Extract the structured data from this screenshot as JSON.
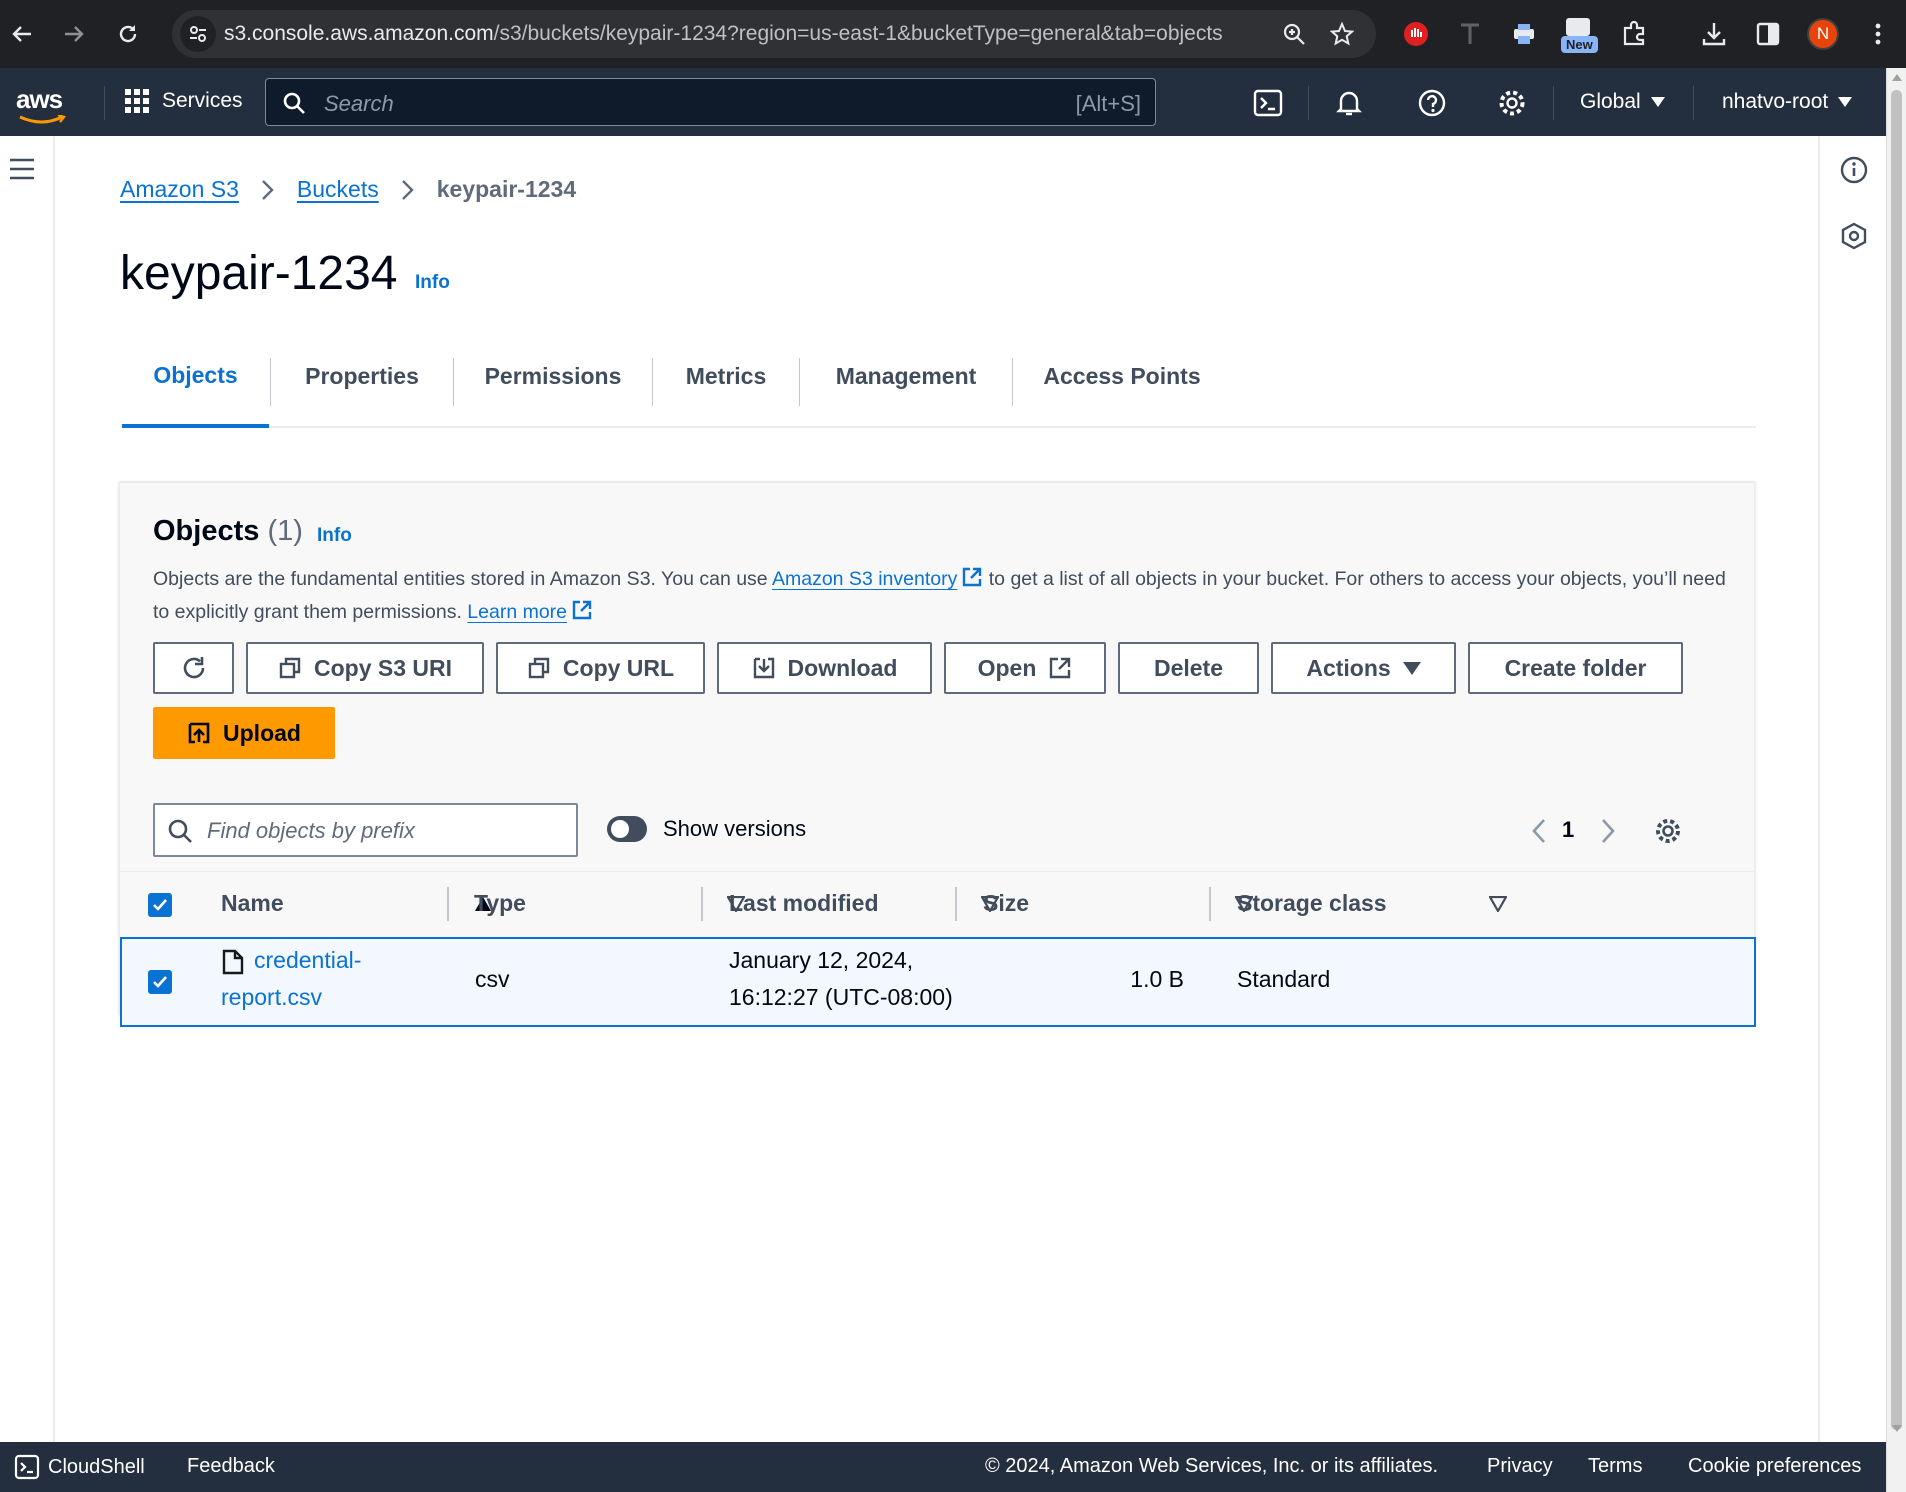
{
  "browser": {
    "url_host": "s3.console.aws.amazon.com",
    "url_path": "/s3/buckets/keypair-1234?region=us-east-1&bucketType=general&tab=objects",
    "new_badge": "New",
    "profile_initial": "N"
  },
  "awsnav": {
    "logo": "aws",
    "services_label": "Services",
    "search_placeholder": "Search",
    "search_shortcut": "[Alt+S]",
    "region": "Global",
    "account": "nhatvo-root"
  },
  "breadcrumb": {
    "items": [
      "Amazon S3",
      "Buckets"
    ],
    "current": "keypair-1234"
  },
  "page": {
    "title": "keypair-1234",
    "info": "Info"
  },
  "tabs": [
    "Objects",
    "Properties",
    "Permissions",
    "Metrics",
    "Management",
    "Access Points"
  ],
  "objects_panel": {
    "title": "Objects",
    "count": "(1)",
    "info": "Info",
    "desc_1": "Objects are the fundamental entities stored in Amazon S3. You can use ",
    "desc_link_1": "Amazon S3 inventory",
    "desc_2": " to get a list of all objects in your bucket. For others to access your objects, you’ll need to explicitly grant them permissions. ",
    "desc_link_2": "Learn more",
    "buttons": {
      "copy_uri": "Copy S3 URI",
      "copy_url": "Copy URL",
      "download": "Download",
      "open": "Open",
      "delete": "Delete",
      "actions": "Actions",
      "create_folder": "Create folder",
      "upload": "Upload"
    },
    "filter_placeholder": "Find objects by prefix",
    "show_versions": "Show versions",
    "page_number": "1"
  },
  "table": {
    "columns": [
      "Name",
      "Type",
      "Last modified",
      "Size",
      "Storage class"
    ],
    "rows": [
      {
        "name_line1": "credential-",
        "name_line2": "report.csv",
        "type": "csv",
        "modified_line1": "January 12, 2024,",
        "modified_line2": "16:12:27 (UTC-08:00)",
        "size": "1.0 B",
        "storage_class": "Standard"
      }
    ]
  },
  "footer": {
    "cloudshell": "CloudShell",
    "feedback": "Feedback",
    "copyright": "© 2024, Amazon Web Services, Inc. or its affiliates.",
    "privacy": "Privacy",
    "terms": "Terms",
    "cookies": "Cookie preferences"
  },
  "colors": {
    "link_blue": "#0972d3",
    "aws_nav": "#232f3e",
    "upload_orange": "#ff9900",
    "chrome_dark": "#202124"
  }
}
